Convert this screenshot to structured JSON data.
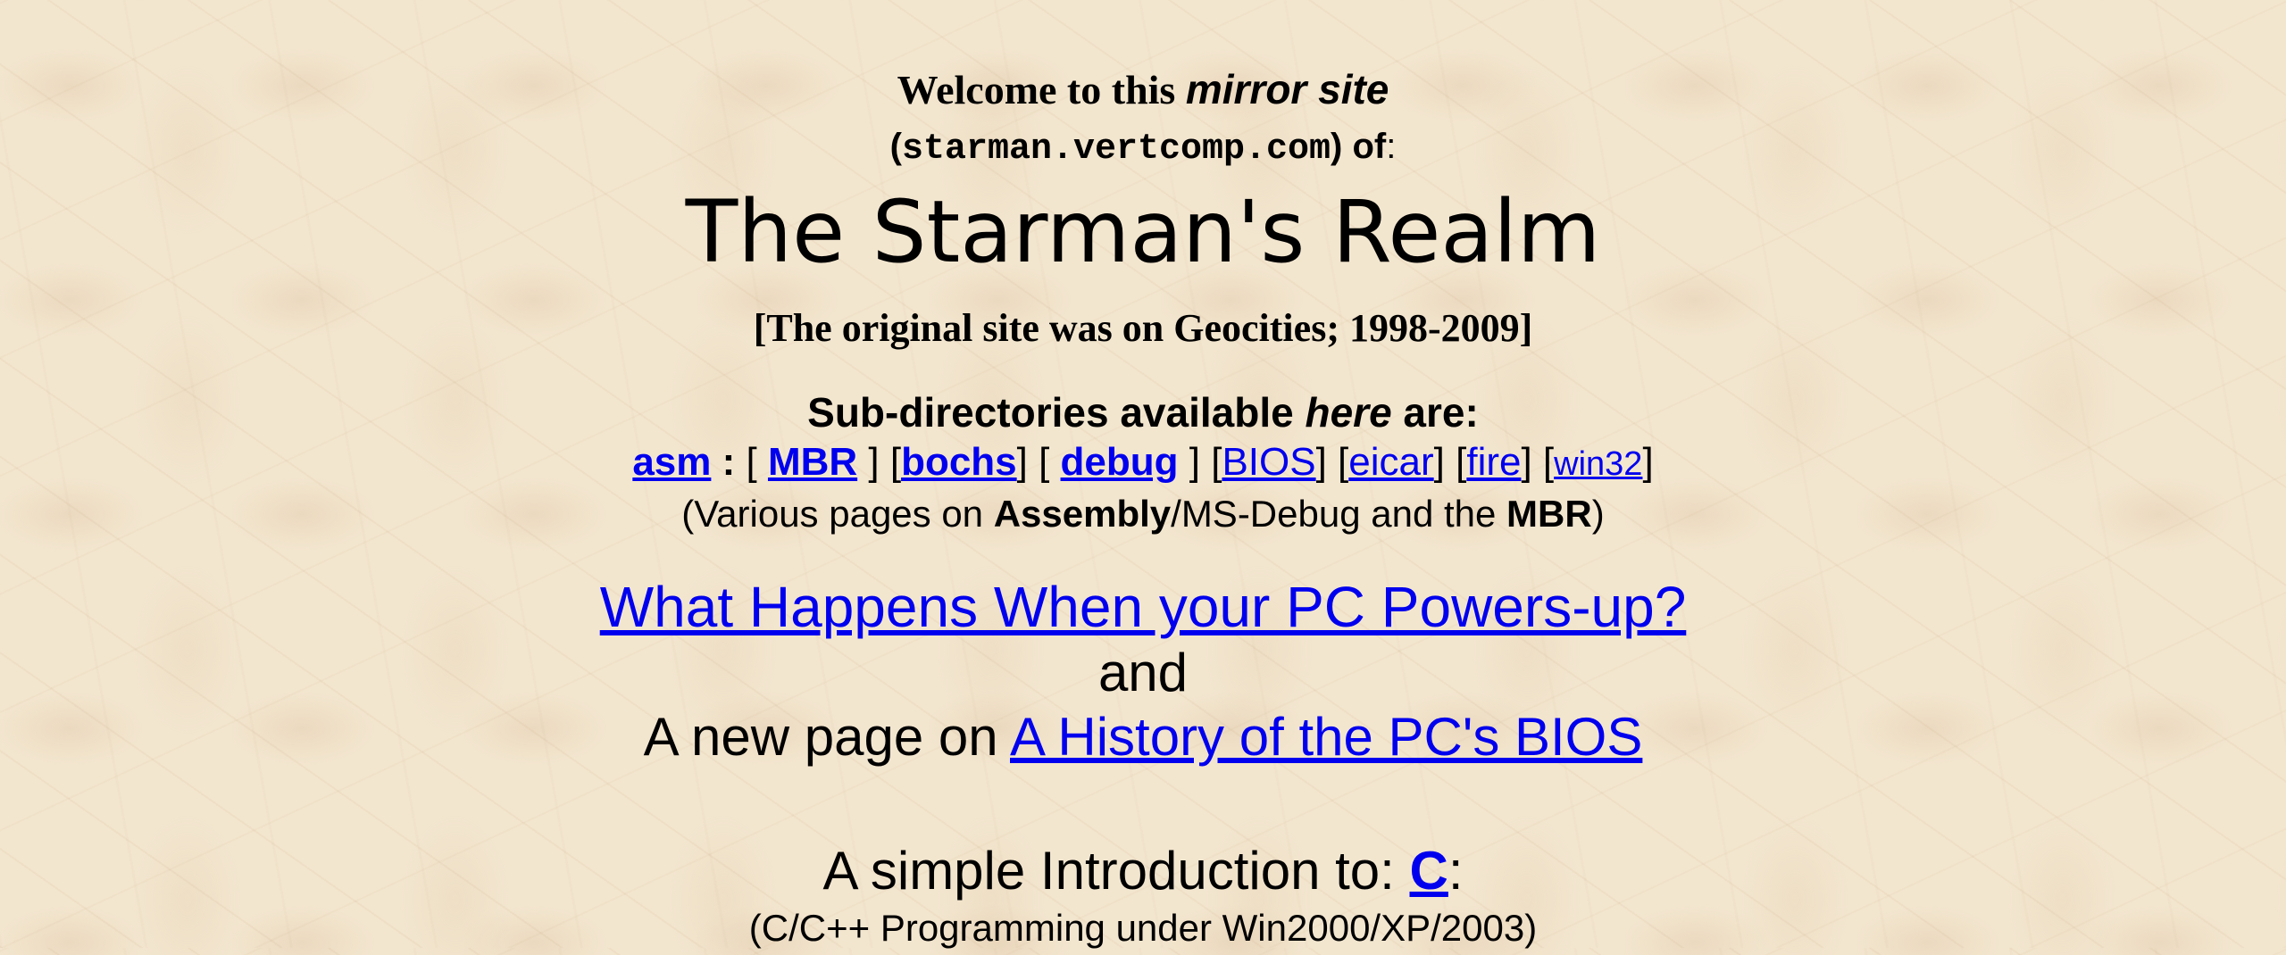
{
  "welcome": {
    "prefix": "Welcome to this ",
    "emphasis": "mirror site"
  },
  "site": {
    "open_paren": "(",
    "domain": "starman.vertcomp.com",
    "close_paren": ")",
    "of": " of",
    "colon": ":"
  },
  "title": "The Starman's Realm",
  "original_note": "[The original site was on Geocities; 1998-2009]",
  "subdirs": {
    "heading_prefix": "Sub-directories available ",
    "heading_em": "here",
    "heading_suffix": " are:",
    "links": {
      "asm": "asm",
      "mbr": "MBR",
      "bochs": "bochs",
      "debug": "debug",
      "bios": "BIOS",
      "eicar": "eicar",
      "fire": "fire",
      "win32": "win32"
    },
    "desc_open": "(Various pages on ",
    "desc_assembly": "Assembly",
    "desc_mid": "/MS-Debug and the ",
    "desc_mbr": "MBR",
    "desc_close": ")"
  },
  "powerup_link": "What Happens When your PC Powers-up?",
  "and_text": "and",
  "bios_history": {
    "prefix": "A new page on ",
    "link": "A History of the PC's BIOS"
  },
  "c_intro": {
    "prefix": "A simple Introduction to: ",
    "link": "C",
    "suffix": ":",
    "desc": "(C/C++ Programming under Win2000/XP/2003)"
  },
  "colors": {
    "link": "#0000ee",
    "background": "#f3e6cf",
    "text": "#000000"
  }
}
